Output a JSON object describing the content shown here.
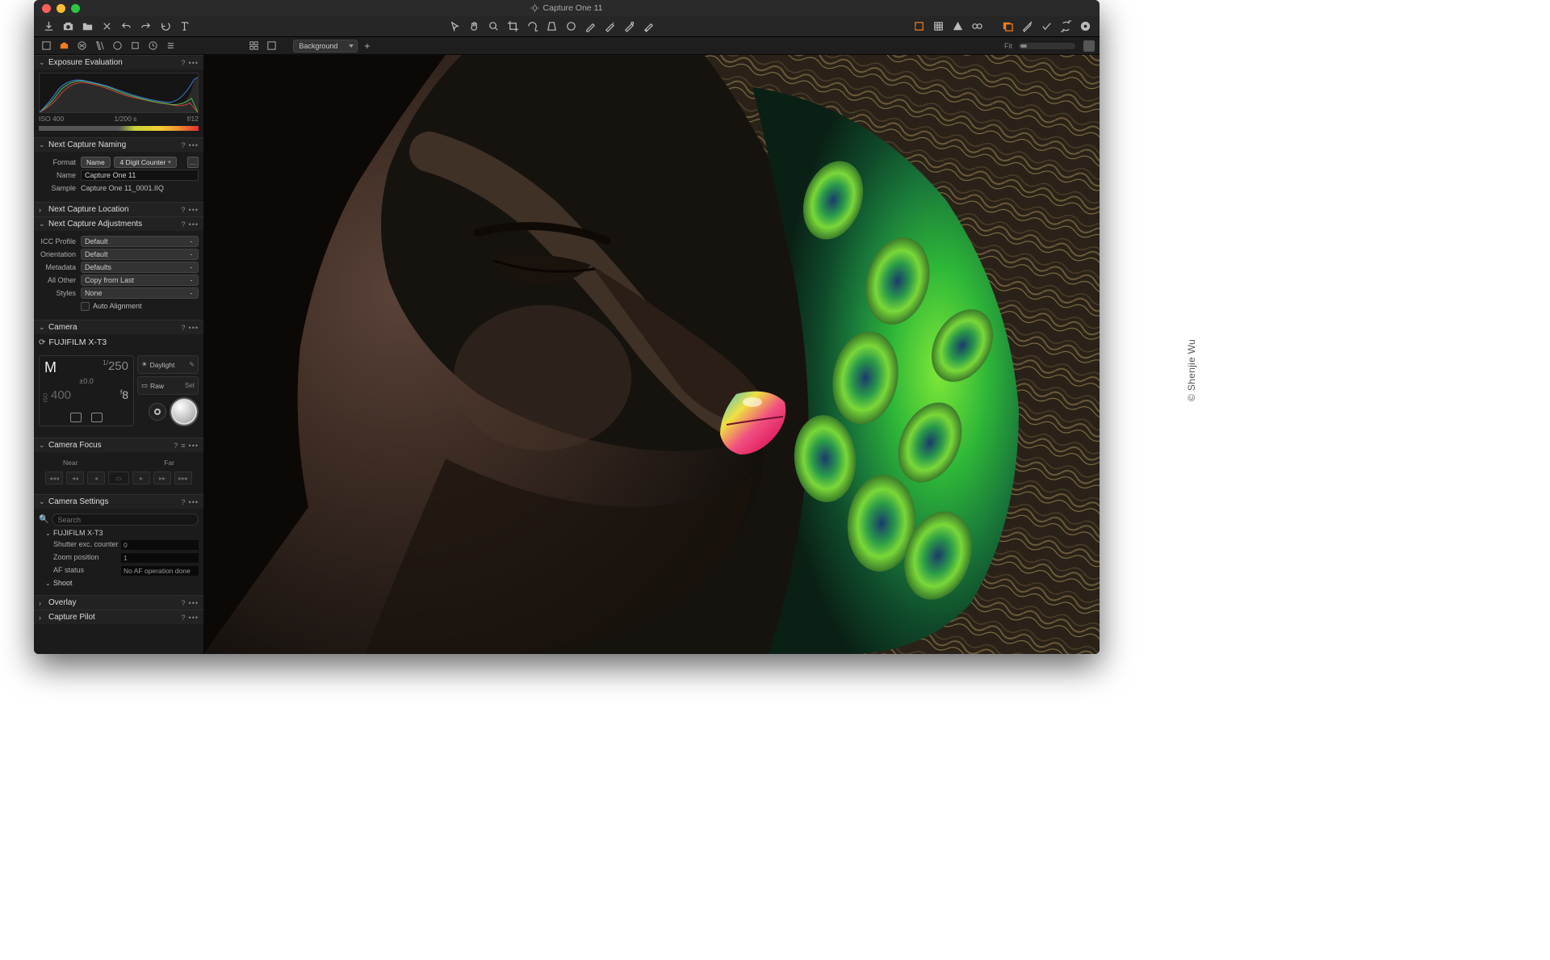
{
  "app": {
    "title": "Capture One 11"
  },
  "credit": "© Shenjie Wu",
  "viewer_toolbar": {
    "layer": "Background",
    "fit_label": "Fit"
  },
  "panels": {
    "exposure_eval": {
      "title": "Exposure Evaluation",
      "iso": "ISO 400",
      "shutter": "1/200 s",
      "aperture": "f/12"
    },
    "next_naming": {
      "title": "Next Capture Naming",
      "format_label": "Format",
      "token1": "Name",
      "token2": "4 Digit Counter",
      "name_label": "Name",
      "name_value": "Capture One 11",
      "sample_label": "Sample",
      "sample_value": "Capture One 11_0001.IIQ"
    },
    "next_location": {
      "title": "Next Capture Location"
    },
    "next_adjust": {
      "title": "Next Capture Adjustments",
      "icc_label": "ICC Profile",
      "icc_value": "Default",
      "orient_label": "Orientation",
      "orient_value": "Default",
      "meta_label": "Metadata",
      "meta_value": "Defaults",
      "all_label": "All Other",
      "all_value": "Copy from Last",
      "styles_label": "Styles",
      "styles_value": "None",
      "auto_align": "Auto Alignment"
    },
    "camera": {
      "title": "Camera",
      "model": "FUJIFILM X-T3",
      "mode": "M",
      "shutter_pre": "1/",
      "shutter_val": "250",
      "ev": "±0.0",
      "iso_label": "ISO",
      "iso_val": "400",
      "fstop_pre": "f",
      "fstop_val": "8",
      "wb_label": "Daylight",
      "format_label": "Raw",
      "set_label": "Set"
    },
    "camera_focus": {
      "title": "Camera Focus",
      "near": "Near",
      "far": "Far"
    },
    "camera_settings": {
      "title": "Camera Settings",
      "search_placeholder": "Search",
      "tree_label": "FUJIFILM X-T3",
      "rows": [
        {
          "label": "Shutter exc. counter",
          "value": "0"
        },
        {
          "label": "Zoom position",
          "value": "1"
        },
        {
          "label": "AF status",
          "value": "No AF operation done"
        }
      ],
      "shoot_label": "Shoot"
    },
    "overlay": {
      "title": "Overlay"
    },
    "capture_pilot": {
      "title": "Capture Pilot"
    }
  }
}
